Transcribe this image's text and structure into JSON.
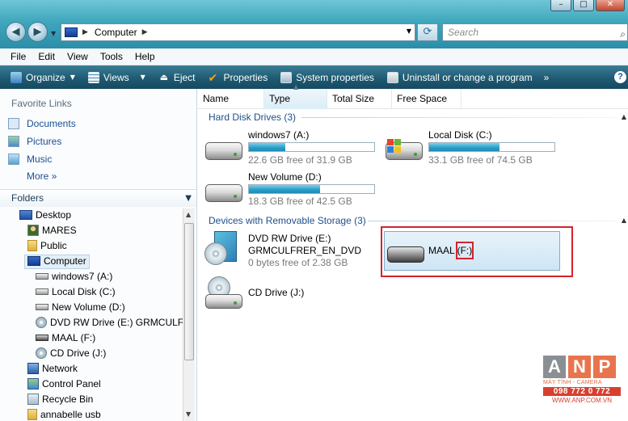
{
  "window": {
    "controls": {
      "minimize": "–",
      "maximize": "□",
      "close": "✕"
    }
  },
  "address": {
    "crumb": "Computer",
    "search_placeholder": "Search"
  },
  "menu": [
    "File",
    "Edit",
    "View",
    "Tools",
    "Help"
  ],
  "toolbar": {
    "organize": "Organize",
    "views": "Views",
    "eject": "Eject",
    "properties": "Properties",
    "system_properties": "System properties",
    "uninstall": "Uninstall or change a program",
    "overflow": "»",
    "help": "?"
  },
  "left": {
    "favorites_header": "Favorite Links",
    "favorites": [
      "Documents",
      "Pictures",
      "Music"
    ],
    "more": "More  »",
    "folders_header": "Folders",
    "tree": [
      {
        "label": "Desktop",
        "icon": "desktop-icon"
      },
      {
        "label": "MARES",
        "icon": "user-folder-icon"
      },
      {
        "label": "Public",
        "icon": "folder-icon"
      },
      {
        "label": "Computer",
        "icon": "computer-icon"
      },
      {
        "label": "windows7 (A:)",
        "icon": "drive-icon"
      },
      {
        "label": "Local Disk (C:)",
        "icon": "drive-icon"
      },
      {
        "label": "New Volume (D:)",
        "icon": "drive-icon"
      },
      {
        "label": "DVD RW Drive (E:) GRMCULFRI",
        "icon": "dvd-icon"
      },
      {
        "label": "MAAL (F:)",
        "icon": "usb-drive-icon"
      },
      {
        "label": "CD Drive (J:)",
        "icon": "dvd-icon"
      },
      {
        "label": "Network",
        "icon": "network-icon"
      },
      {
        "label": "Control Panel",
        "icon": "control-panel-icon"
      },
      {
        "label": "Recycle Bin",
        "icon": "recycle-bin-icon"
      },
      {
        "label": "annabelle usb",
        "icon": "folder-icon"
      }
    ]
  },
  "columns": [
    "Name",
    "Type",
    "Total Size",
    "Free Space"
  ],
  "groups": {
    "hdd": "Hard Disk Drives (3)",
    "removable": "Devices with Removable Storage (3)"
  },
  "drives": [
    {
      "name": "windows7 (A:)",
      "free": "22.6 GB free of 31.9 GB",
      "used_fraction": 0.29
    },
    {
      "name": "Local Disk (C:)",
      "free": "33.1 GB free of 74.5 GB",
      "used_fraction": 0.56
    },
    {
      "name": "New Volume (D:)",
      "free": "18.3 GB free of 42.5 GB",
      "used_fraction": 0.57
    }
  ],
  "removable": [
    {
      "name": "DVD RW Drive (E:)",
      "label": "GRMCULFRER_EN_DVD",
      "free": "0 bytes free of 2.38 GB"
    },
    {
      "name": "MAAL",
      "letter": "(F:)"
    },
    {
      "name": "CD Drive (J:)"
    }
  ],
  "watermark": {
    "letters": [
      "A",
      "N",
      "P"
    ],
    "tagline": "MÁY TÍNH - CAMERA",
    "phone": "098 772 0 772",
    "web": "WWW.ANP.COM.VN"
  },
  "colors": {
    "toolbar": "#1f5a73",
    "bar_fill": "#2a9fc8",
    "highlight": "#d4232e",
    "link": "#1c4f93"
  }
}
